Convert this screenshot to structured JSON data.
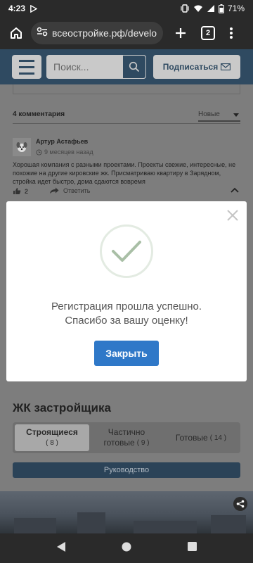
{
  "status": {
    "time": "4:23",
    "battery": "71%"
  },
  "browser": {
    "url": "всеостройке.рф/developer/z",
    "tab_count": "2"
  },
  "header": {
    "search_placeholder": "Поиск...",
    "subscribe_label": "Подписаться"
  },
  "comments": {
    "count_label": "4 комментария",
    "sort_label": "Новые",
    "items": [
      {
        "author": "Артур Астафьев",
        "date": "9 месяцев назад",
        "text": "Хорошая компания с разными проектами. Проекты свежие, интересные, не похожие на другие кировские жк. Присматриваю квартиру в Зарядном, стройка идет быстро, дома сдаются вовремя",
        "likes": "2",
        "reply_label": "Ответить"
      }
    ]
  },
  "section": {
    "title": "ЖК застройщика",
    "tabs": [
      {
        "label": "Строящиеся",
        "count": "8"
      },
      {
        "label_line1": "Частично",
        "label_line2": "готовые",
        "count": "9"
      },
      {
        "label": "Готовые",
        "count": "14"
      }
    ],
    "guide_label": "Руководство"
  },
  "modal": {
    "line1": "Регистрация прошла успешно.",
    "line2": "Спасибо за вашу оценку!",
    "button_label": "Закрыть"
  },
  "colors": {
    "header_bg": "#2f4a61",
    "modal_button": "#2f78c8",
    "check_mark": "#a9bfa6"
  }
}
